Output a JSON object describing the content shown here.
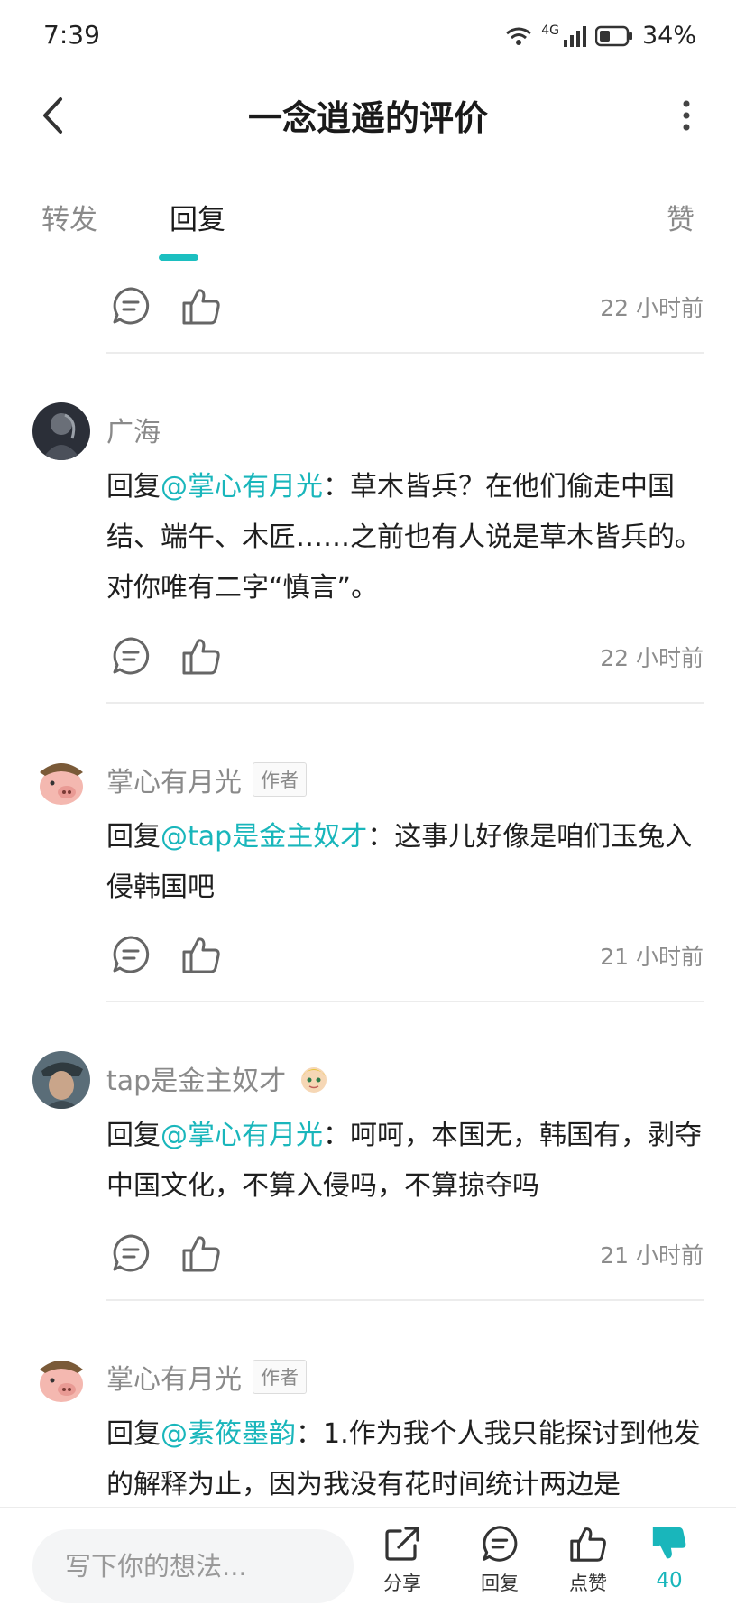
{
  "status_bar": {
    "time": "7:39",
    "network": "4G",
    "battery": "34%"
  },
  "header": {
    "title": "一念逍遥的评价"
  },
  "tabs": [
    {
      "label": "转发",
      "active": false
    },
    {
      "label": "回复",
      "active": true
    },
    {
      "label": "赞",
      "active": false
    }
  ],
  "first_row": {
    "time": "22 小时前"
  },
  "comments": [
    {
      "user": "广海",
      "author_tag": "",
      "reply_prefix": "回复",
      "mention": "@掌心有月光",
      "text": "：草木皆兵？在他们偷走中国结、端午、木匠……之前也有人说是草木皆兵的。对你唯有二字“慎言”。",
      "time": "22 小时前"
    },
    {
      "user": "掌心有月光",
      "author_tag": "作者",
      "reply_prefix": "回复",
      "mention": "@tap是金主奴才",
      "text": "：这事儿好像是咱们玉兔入侵韩国吧",
      "time": "21 小时前"
    },
    {
      "user": "tap是金主奴才",
      "author_tag": "",
      "reply_prefix": "回复",
      "mention": "@掌心有月光",
      "text": "：呵呵，本国无，韩国有，剥夺中国文化，不算入侵吗，不算掠夺吗",
      "time": "21 小时前"
    },
    {
      "user": "掌心有月光",
      "author_tag": "作者",
      "reply_prefix": "回复",
      "mention": "@素筱墨韵",
      "text": "：1.作为我个人我只能探讨到他发的解释为止，因为我没有花时间统计两边是",
      "time": ""
    }
  ],
  "bottom_bar": {
    "input_placeholder": "写下你的想法...",
    "share_label": "分享",
    "reply_label": "回复",
    "like_label": "点赞",
    "dislike_count": "40"
  },
  "colors": {
    "accent": "#19b6bb",
    "muted": "#8a8a8a",
    "divider": "#ececec"
  },
  "icons": [
    "back-icon",
    "more-icon",
    "comment-icon",
    "thumbs-up-icon",
    "share-icon",
    "thumbs-down-icon"
  ]
}
